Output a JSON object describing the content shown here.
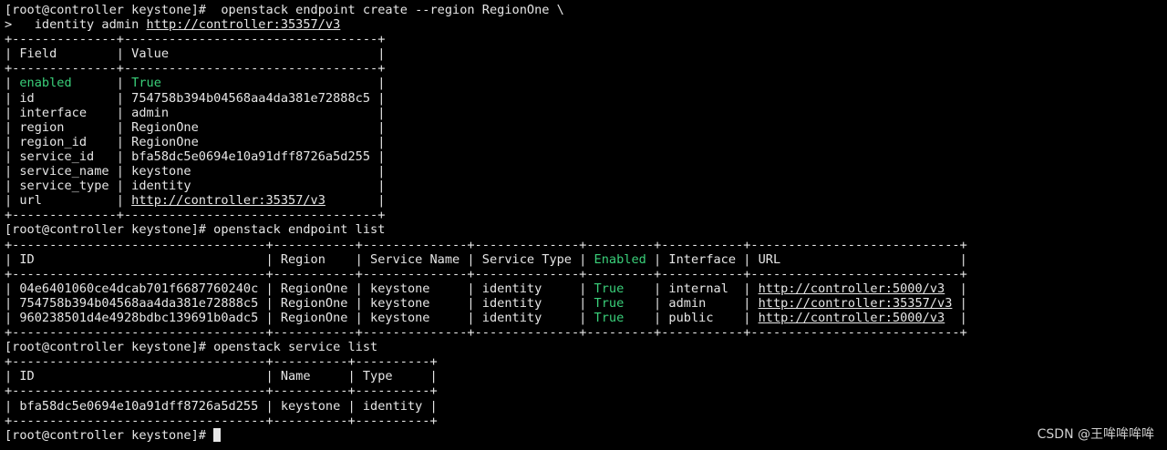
{
  "terminal": {
    "lines": [
      {
        "segments": [
          {
            "text": "[root@controller keystone]#  openstack endpoint create --region RegionOne \\"
          }
        ]
      },
      {
        "segments": [
          {
            "text": ">   identity admin "
          },
          {
            "text": "http://controller:35357/v3",
            "style": "link"
          }
        ]
      },
      {
        "segments": [
          {
            "text": "+--------------+----------------------------------+"
          }
        ]
      },
      {
        "segments": [
          {
            "text": "| Field        | Value                            |"
          }
        ]
      },
      {
        "segments": [
          {
            "text": "+--------------+----------------------------------+"
          }
        ]
      },
      {
        "segments": [
          {
            "text": "| "
          },
          {
            "text": "enabled",
            "style": "green"
          },
          {
            "text": "      | "
          },
          {
            "text": "True",
            "style": "green"
          },
          {
            "text": "                             |"
          }
        ]
      },
      {
        "segments": [
          {
            "text": "| id           | 754758b394b04568aa4da381e72888c5 |"
          }
        ]
      },
      {
        "segments": [
          {
            "text": "| interface    | admin                            |"
          }
        ]
      },
      {
        "segments": [
          {
            "text": "| region       | RegionOne                        |"
          }
        ]
      },
      {
        "segments": [
          {
            "text": "| region_id    | RegionOne                        |"
          }
        ]
      },
      {
        "segments": [
          {
            "text": "| service_id   | bfa58dc5e0694e10a91dff8726a5d255 |"
          }
        ]
      },
      {
        "segments": [
          {
            "text": "| service_name | keystone                         |"
          }
        ]
      },
      {
        "segments": [
          {
            "text": "| service_type | identity                         |"
          }
        ]
      },
      {
        "segments": [
          {
            "text": "| url          | "
          },
          {
            "text": "http://controller:35357/v3",
            "style": "link"
          },
          {
            "text": "       |"
          }
        ]
      },
      {
        "segments": [
          {
            "text": "+--------------+----------------------------------+"
          }
        ]
      },
      {
        "segments": [
          {
            "text": "[root@controller keystone]# openstack endpoint list"
          }
        ]
      },
      {
        "segments": [
          {
            "text": "+----------------------------------+-----------+--------------+--------------+---------+-----------+----------------------------+"
          }
        ]
      },
      {
        "segments": [
          {
            "text": "| ID                               | Region    | Service Name | Service Type | "
          },
          {
            "text": "Enabled",
            "style": "green"
          },
          {
            "text": " | Interface | URL                        |"
          }
        ]
      },
      {
        "segments": [
          {
            "text": "+----------------------------------+-----------+--------------+--------------+---------+-----------+----------------------------+"
          }
        ]
      },
      {
        "segments": [
          {
            "text": "| 04e6401060ce4dcab701f6687760240c | RegionOne | keystone     | identity     | "
          },
          {
            "text": "True",
            "style": "green"
          },
          {
            "text": "    | internal  | "
          },
          {
            "text": "http://controller:5000/v3",
            "style": "link"
          },
          {
            "text": "  |"
          }
        ]
      },
      {
        "segments": [
          {
            "text": "| 754758b394b04568aa4da381e72888c5 | RegionOne | keystone     | identity     | "
          },
          {
            "text": "True",
            "style": "green"
          },
          {
            "text": "    | admin     | "
          },
          {
            "text": "http://controller:35357/v3",
            "style": "link"
          },
          {
            "text": " |"
          }
        ]
      },
      {
        "segments": [
          {
            "text": "| 960238501d4e4928bdbc139691b0adc5 | RegionOne | keystone     | identity     | "
          },
          {
            "text": "True",
            "style": "green"
          },
          {
            "text": "    | public    | "
          },
          {
            "text": "http://controller:5000/v3",
            "style": "link"
          },
          {
            "text": "  |"
          }
        ]
      },
      {
        "segments": [
          {
            "text": "+----------------------------------+-----------+--------------+--------------+---------+-----------+----------------------------+"
          }
        ]
      },
      {
        "segments": [
          {
            "text": "[root@controller keystone]# openstack service list"
          }
        ]
      },
      {
        "segments": [
          {
            "text": "+----------------------------------+----------+----------+"
          }
        ]
      },
      {
        "segments": [
          {
            "text": "| ID                               | Name     | Type     |"
          }
        ]
      },
      {
        "segments": [
          {
            "text": "+----------------------------------+----------+----------+"
          }
        ]
      },
      {
        "segments": [
          {
            "text": "| bfa58dc5e0694e10a91dff8726a5d255 | keystone | identity |"
          }
        ]
      },
      {
        "segments": [
          {
            "text": "+----------------------------------+----------+----------+"
          }
        ]
      },
      {
        "segments": [
          {
            "text": "[root@controller keystone]# "
          }
        ],
        "cursor": true
      }
    ]
  },
  "watermark": "CSDN @王哞哞哞哞",
  "colors": {
    "background": "#000000",
    "text": "#e6e6e6",
    "accent_green": "#3ad07a"
  }
}
